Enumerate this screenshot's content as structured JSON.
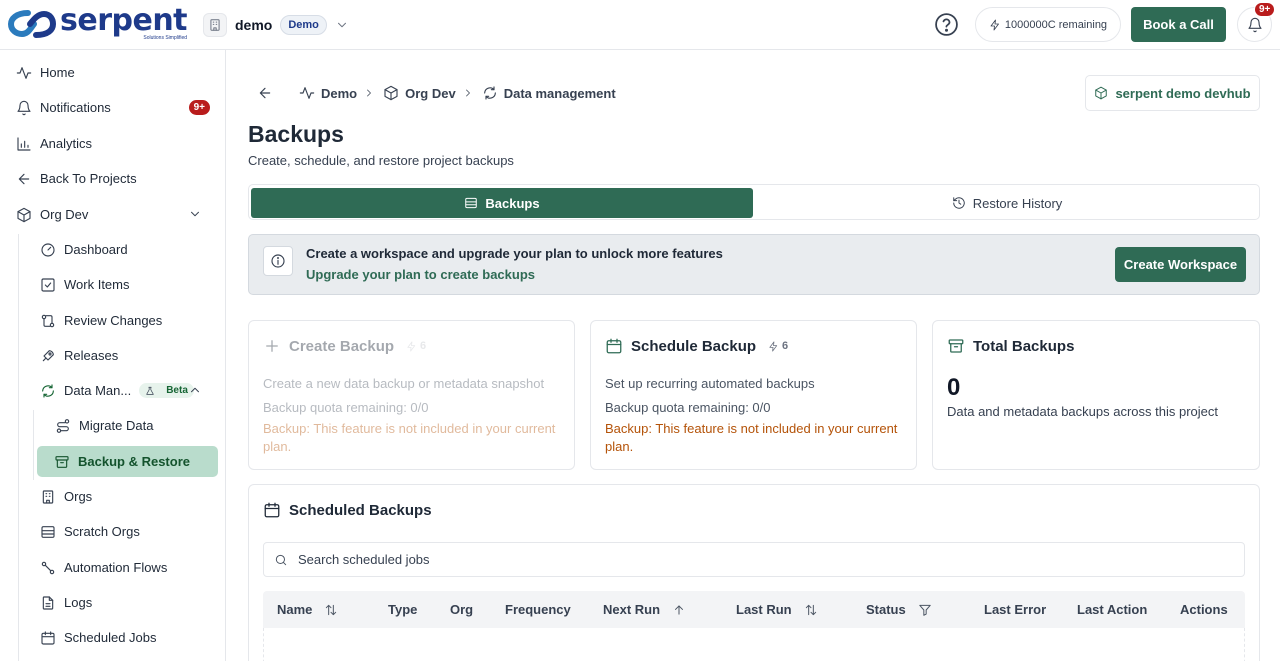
{
  "brand": {
    "name": "serpent",
    "tagline": "Solutions Simplified"
  },
  "header": {
    "org_name": "demo",
    "org_badge": "Demo",
    "credits": "1000000C remaining",
    "book_call": "Book a Call",
    "bell_badge": "9+"
  },
  "sidebar": {
    "items": [
      {
        "label": "Home",
        "icon": "activity-icon"
      },
      {
        "label": "Notifications",
        "icon": "bell-icon",
        "badge": "9+"
      },
      {
        "label": "Analytics",
        "icon": "bar-chart-icon"
      },
      {
        "label": "Back To Projects",
        "icon": "arrow-left-icon"
      },
      {
        "label": "Org Dev",
        "icon": "package-icon"
      }
    ],
    "sub_items": [
      {
        "label": "Dashboard",
        "icon": "gauge-icon"
      },
      {
        "label": "Work Items",
        "icon": "checkbox-icon"
      },
      {
        "label": "Review Changes",
        "icon": "git-compare-icon"
      },
      {
        "label": "Releases",
        "icon": "rocket-icon"
      },
      {
        "label": "Data Man...",
        "icon": "refresh-icon",
        "badge": "Beta"
      }
    ],
    "data_items": [
      {
        "label": "Migrate Data",
        "icon": "route-icon"
      },
      {
        "label": "Backup & Restore",
        "icon": "archive-icon"
      }
    ],
    "more_items": [
      {
        "label": "Orgs",
        "icon": "building-icon"
      },
      {
        "label": "Scratch Orgs",
        "icon": "database-icon"
      },
      {
        "label": "Automation Flows",
        "icon": "workflow-icon"
      },
      {
        "label": "Logs",
        "icon": "file-text-icon"
      },
      {
        "label": "Scheduled Jobs",
        "icon": "calendar-icon"
      }
    ]
  },
  "breadcrumb": [
    "Demo",
    "Org Dev",
    "Data management"
  ],
  "devhub": "serpent demo devhub",
  "page": {
    "title": "Backups",
    "subtitle": "Create, schedule, and restore project backups"
  },
  "tabs": [
    "Backups",
    "Restore History"
  ],
  "notice": {
    "title": "Create a workspace and upgrade your plan to unlock more features",
    "subtitle": "Upgrade your plan to create backups",
    "button": "Create Workspace"
  },
  "cards": {
    "create": {
      "title": "Create Backup",
      "cost": "6",
      "desc": "Create a new data backup or metadata snapshot",
      "quota": "Backup quota remaining: 0/0",
      "warning": "Backup: This feature is not included in your current plan."
    },
    "schedule": {
      "title": "Schedule Backup",
      "cost": "6",
      "desc": "Set up recurring automated backups",
      "quota": "Backup quota remaining: 0/0",
      "warning": "Backup: This feature is not included in your current plan."
    },
    "total": {
      "title": "Total Backups",
      "value": "0",
      "desc": "Data and metadata backups across this project"
    }
  },
  "scheduled": {
    "title": "Scheduled Backups",
    "search_placeholder": "Search scheduled jobs",
    "columns": [
      "Name",
      "Type",
      "Org",
      "Frequency",
      "Next Run",
      "Last Run",
      "Status",
      "Last Error",
      "Last Action",
      "Actions"
    ]
  },
  "colors": {
    "primary": "#2f6b55",
    "active_nav": "#b9dccc",
    "badge": "#b91c1c",
    "warning": "#b45309"
  }
}
